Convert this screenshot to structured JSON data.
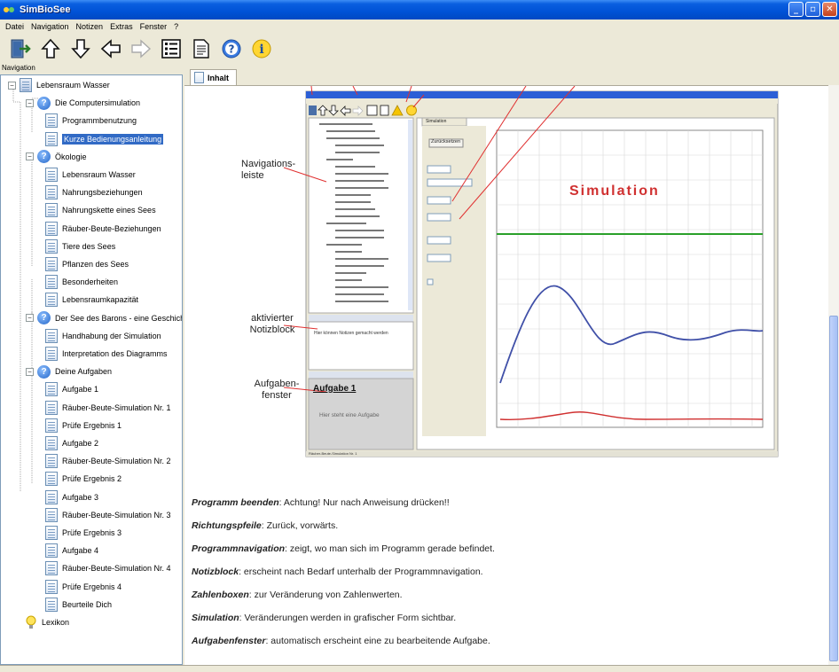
{
  "window": {
    "title": "SimBioSee"
  },
  "menu": [
    "Datei",
    "Navigation",
    "Notizen",
    "Extras",
    "Fenster",
    "?"
  ],
  "toolbar": {
    "icons": [
      "exit-icon",
      "arrow-up-icon",
      "arrow-down-icon",
      "arrow-left-icon",
      "arrow-right-icon",
      "notes-list-icon",
      "document-icon",
      "help-icon",
      "info-icon"
    ]
  },
  "navigation": {
    "label": "Navigation",
    "tree": [
      {
        "label": "Lebensraum Wasser",
        "level": 0,
        "icon": "book"
      },
      {
        "label": "Die Computersimulation",
        "level": 1,
        "icon": "help"
      },
      {
        "label": "Programmbenutzung",
        "level": 2,
        "icon": "doc"
      },
      {
        "label": "Kurze Bedienungsanleitung",
        "level": 2,
        "icon": "doc",
        "selected": true
      },
      {
        "label": "Ökologie",
        "level": 1,
        "icon": "help"
      },
      {
        "label": "Lebensraum Wasser",
        "level": 2,
        "icon": "doc"
      },
      {
        "label": "Nahrungsbeziehungen",
        "level": 2,
        "icon": "doc"
      },
      {
        "label": "Nahrungskette eines Sees",
        "level": 2,
        "icon": "doc"
      },
      {
        "label": "Räuber-Beute-Beziehungen",
        "level": 2,
        "icon": "doc"
      },
      {
        "label": "Tiere des Sees",
        "level": 2,
        "icon": "doc"
      },
      {
        "label": "Pflanzen des Sees",
        "level": 2,
        "icon": "doc"
      },
      {
        "label": "Besonderheiten",
        "level": 2,
        "icon": "doc"
      },
      {
        "label": "Lebensraumkapazität",
        "level": 2,
        "icon": "doc"
      },
      {
        "label": "Der See des Barons - eine Geschichte",
        "level": 1,
        "icon": "help"
      },
      {
        "label": "Handhabung der Simulation",
        "level": 2,
        "icon": "doc"
      },
      {
        "label": "Interpretation des Diagramms",
        "level": 2,
        "icon": "doc"
      },
      {
        "label": "Deine Aufgaben",
        "level": 1,
        "icon": "help"
      },
      {
        "label": "Aufgabe 1",
        "level": 2,
        "icon": "doc"
      },
      {
        "label": "Räuber-Beute-Simulation Nr. 1",
        "level": 2,
        "icon": "doc"
      },
      {
        "label": "Prüfe Ergebnis 1",
        "level": 2,
        "icon": "doc"
      },
      {
        "label": "Aufgabe 2",
        "level": 2,
        "icon": "doc"
      },
      {
        "label": "Räuber-Beute-Simulation Nr. 2",
        "level": 2,
        "icon": "doc"
      },
      {
        "label": "Prüfe Ergebnis 2",
        "level": 2,
        "icon": "doc"
      },
      {
        "label": "Aufgabe 3",
        "level": 2,
        "icon": "doc"
      },
      {
        "label": "Räuber-Beute-Simulation Nr. 3",
        "level": 2,
        "icon": "doc"
      },
      {
        "label": "Prüfe Ergebnis 3",
        "level": 2,
        "icon": "doc"
      },
      {
        "label": "Aufgabe 4",
        "level": 2,
        "icon": "doc"
      },
      {
        "label": "Räuber-Beute-Simulation Nr. 4",
        "level": 2,
        "icon": "doc"
      },
      {
        "label": "Prüfe Ergebnis 4",
        "level": 2,
        "icon": "doc"
      },
      {
        "label": "Beurteile Dich",
        "level": 2,
        "icon": "doc"
      },
      {
        "label": "Lexikon",
        "level": 1,
        "icon": "bulb"
      }
    ]
  },
  "content": {
    "tab_label": "Inhalt",
    "screenshot": {
      "callouts": {
        "navigation": "Navigations-\nleiste",
        "notepad": "aktivierter\nNotizblock",
        "taskwindow": "Aufgaben-\nfenster"
      },
      "simulation_label": "Simulation",
      "inner_tab": "Simulation",
      "inner_button": "Zurücksetzen",
      "task_title": "Aufgabe 1",
      "task_text": "Hier steht eine Aufgabe",
      "notes_text": "Hier können Notizen gemacht werden",
      "status": "Räuber-Beute-Simulation Nr. 1"
    },
    "descriptions": [
      {
        "term": "Programm beenden",
        "text": ": Achtung! Nur nach Anweisung drücken!!"
      },
      {
        "term": "Richtungspfeile",
        "text": ": Zurück, vorwärts."
      },
      {
        "term": "Programmnavigation",
        "text": ": zeigt, wo man sich im Programm gerade befindet."
      },
      {
        "term": "Notizblock",
        "text": ": erscheint nach Bedarf unterhalb der Programmnavigation."
      },
      {
        "term": "Zahlenboxen",
        "text": ": zur Veränderung von Zahlenwerten."
      },
      {
        "term": "Simulation",
        "text": ": Veränderungen werden in grafischer Form sichtbar."
      },
      {
        "term": "Aufgabenfenster",
        "text": ": automatisch erscheint eine zu bearbeitende Aufgabe."
      }
    ]
  },
  "colors": {
    "title_blue": "#0052d6",
    "selection": "#316ac5",
    "callout_red": "#e03030",
    "sim_green": "#2aa02a",
    "sim_blue": "#4050a8"
  }
}
